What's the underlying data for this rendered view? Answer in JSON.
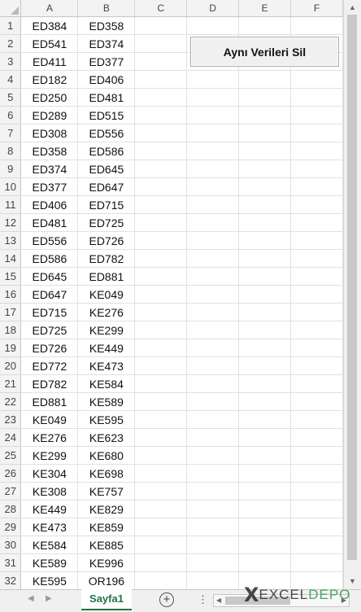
{
  "columns": [
    "A",
    "B",
    "C",
    "D",
    "E",
    "F"
  ],
  "rows": [
    {
      "num": "1",
      "a": "ED384",
      "b": "ED358"
    },
    {
      "num": "2",
      "a": "ED541",
      "b": "ED374"
    },
    {
      "num": "3",
      "a": "ED411",
      "b": "ED377"
    },
    {
      "num": "4",
      "a": "ED182",
      "b": "ED406"
    },
    {
      "num": "5",
      "a": "ED250",
      "b": "ED481"
    },
    {
      "num": "6",
      "a": "ED289",
      "b": "ED515"
    },
    {
      "num": "7",
      "a": "ED308",
      "b": "ED556"
    },
    {
      "num": "8",
      "a": "ED358",
      "b": "ED586"
    },
    {
      "num": "9",
      "a": "ED374",
      "b": "ED645"
    },
    {
      "num": "10",
      "a": "ED377",
      "b": "ED647"
    },
    {
      "num": "11",
      "a": "ED406",
      "b": "ED715"
    },
    {
      "num": "12",
      "a": "ED481",
      "b": "ED725"
    },
    {
      "num": "13",
      "a": "ED556",
      "b": "ED726"
    },
    {
      "num": "14",
      "a": "ED586",
      "b": "ED782"
    },
    {
      "num": "15",
      "a": "ED645",
      "b": "ED881"
    },
    {
      "num": "16",
      "a": "ED647",
      "b": "KE049"
    },
    {
      "num": "17",
      "a": "ED715",
      "b": "KE276"
    },
    {
      "num": "18",
      "a": "ED725",
      "b": "KE299"
    },
    {
      "num": "19",
      "a": "ED726",
      "b": "KE449"
    },
    {
      "num": "20",
      "a": "ED772",
      "b": "KE473"
    },
    {
      "num": "21",
      "a": "ED782",
      "b": "KE584"
    },
    {
      "num": "22",
      "a": "ED881",
      "b": "KE589"
    },
    {
      "num": "23",
      "a": "KE049",
      "b": "KE595"
    },
    {
      "num": "24",
      "a": "KE276",
      "b": "KE623"
    },
    {
      "num": "25",
      "a": "KE299",
      "b": "KE680"
    },
    {
      "num": "26",
      "a": "KE304",
      "b": "KE698"
    },
    {
      "num": "27",
      "a": "KE308",
      "b": "KE757"
    },
    {
      "num": "28",
      "a": "KE449",
      "b": "KE829"
    },
    {
      "num": "29",
      "a": "KE473",
      "b": "KE859"
    },
    {
      "num": "30",
      "a": "KE584",
      "b": "KE885"
    },
    {
      "num": "31",
      "a": "KE589",
      "b": "KE996"
    },
    {
      "num": "32",
      "a": "KE595",
      "b": "OR196"
    }
  ],
  "macro_button": {
    "label": "Aynı Verileri Sil"
  },
  "sheet_tab": {
    "label": "Sayfa1"
  },
  "watermark": {
    "x": "X",
    "excel": "EXCEL",
    "depo": "DEPO"
  },
  "colors": {
    "accent": "#217346",
    "grid": "#e1e1e1",
    "header_bg": "#f3f3f3",
    "depo_green": "#2e9b4a"
  },
  "icons": [
    "prev-sheet-icon",
    "next-sheet-icon",
    "add-sheet-icon",
    "more-options-icon",
    "scroll-up-icon",
    "scroll-down-icon",
    "scroll-left-icon",
    "scroll-right-icon"
  ]
}
